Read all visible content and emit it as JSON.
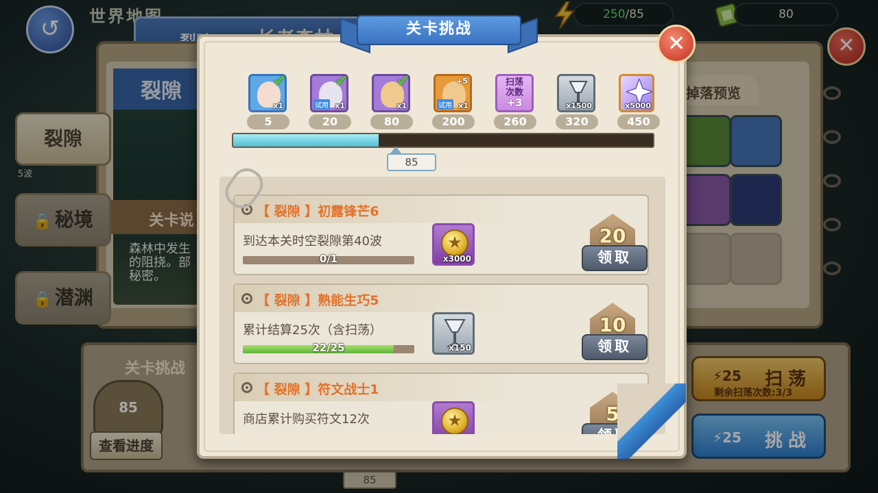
{
  "topbar": {
    "energy_current": "250",
    "energy_max": "/85",
    "tickets": "80",
    "world_title": "世界地图",
    "tab_label": "裂隙",
    "tab_title": "长者森林"
  },
  "background": {
    "section_title": "裂隙",
    "level_desc_label": "关卡说",
    "level_desc_text": "森林中发生的阻挠。部秘密。",
    "wave_text": "5波",
    "side_buttons": [
      "裂隙",
      "秘境",
      "潜渊"
    ],
    "drop_preview_title": "掉落预览",
    "bottom_panel_label": "关卡挑战",
    "bottom_emblem_value": "85",
    "view_progress_label": "查看进度",
    "bottom_progress_value": "85",
    "sweep_button": {
      "cost": "25",
      "label": "扫荡",
      "sub": "剩余扫荡次数:3/3"
    },
    "challenge_button": {
      "cost": "25",
      "label": "挑战"
    }
  },
  "modal": {
    "title": "关卡挑战",
    "close_symbol": "✕",
    "progress_current": 85,
    "progress_max": 450,
    "progress_label": "85",
    "rewards": [
      {
        "milestone": "5",
        "qty": "x1",
        "kind": "hero-card",
        "tag": "",
        "claimed": true,
        "color": "#5fa8e8"
      },
      {
        "milestone": "20",
        "qty": "x1",
        "kind": "hero-card",
        "tag": "试用",
        "claimed": true,
        "color": "#a47bd8"
      },
      {
        "milestone": "80",
        "qty": "x1",
        "kind": "hero-card",
        "tag": "",
        "claimed": true,
        "color": "#a47bd8"
      },
      {
        "milestone": "200",
        "qty": "x1",
        "kind": "hero-card",
        "tag": "试用",
        "claimed": false,
        "plus": "+5",
        "color": "#e89a3a"
      },
      {
        "milestone": "260",
        "qty": "+3",
        "kind": "sweep-count",
        "label_line1": "扫荡",
        "label_line2": "次数",
        "claimed": false
      },
      {
        "milestone": "320",
        "qty": "x1500",
        "kind": "goblet",
        "claimed": false
      },
      {
        "milestone": "450",
        "qty": "x5000",
        "kind": "crystal",
        "claimed": false
      }
    ],
    "tasks": [
      {
        "title": "【 裂隙 】初露锋芒6",
        "desc": "到达本关时空裂隙第40波",
        "progress_text": "0/1",
        "progress_fraction": 0.0,
        "reward_kind": "coin",
        "reward_qty": "x3000",
        "points": "20",
        "claim_label": "领取"
      },
      {
        "title": "【 裂隙 】熟能生巧5",
        "desc": "累计结算25次（含扫荡）",
        "progress_text": "22/25",
        "progress_fraction": 0.88,
        "reward_kind": "goblet",
        "reward_qty": "x150",
        "points": "10",
        "claim_label": "领取"
      },
      {
        "title": "【 裂隙 】符文战士1",
        "desc": "商店累计购买符文12次",
        "progress_text": "",
        "progress_fraction": 0.0,
        "reward_kind": "coin",
        "reward_qty": "",
        "points": "5",
        "claim_label": "领取"
      }
    ]
  },
  "colors": {
    "accent_blue": "#3a73c0",
    "title_orange": "#e3722a",
    "progress_cyan": "#53bdd6",
    "bar_green": "#5fb33a",
    "close_red": "#c62f1d"
  }
}
